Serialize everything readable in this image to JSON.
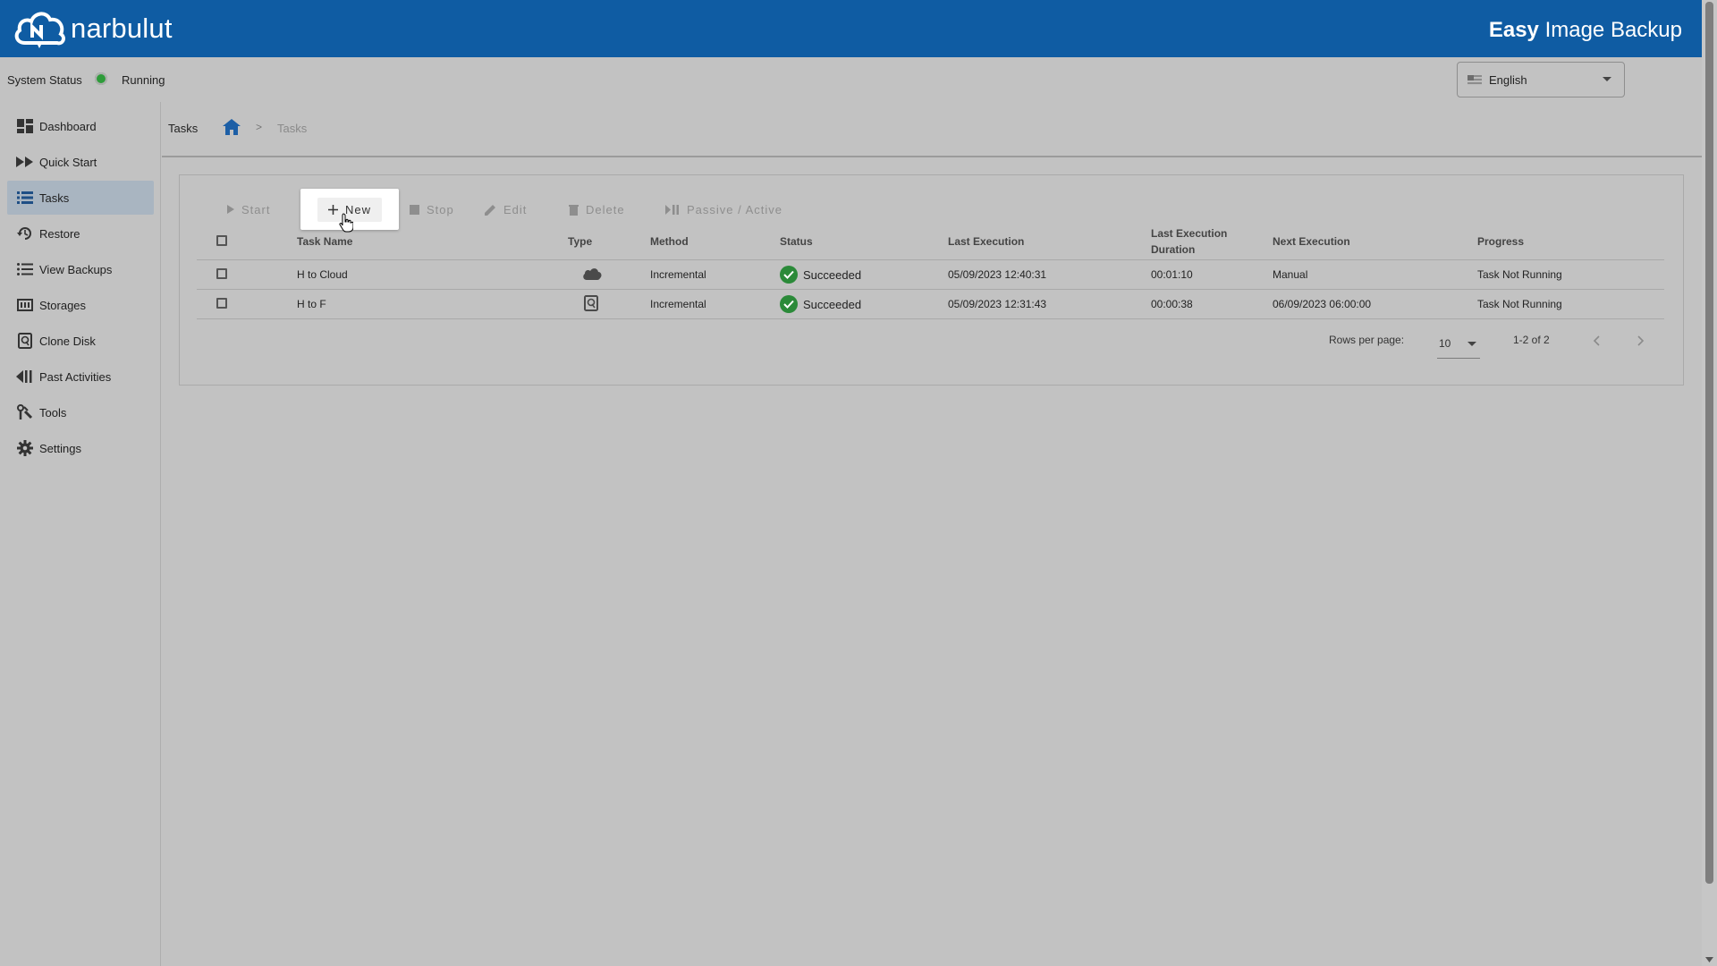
{
  "brand": {
    "logo_text": "narbulut"
  },
  "app_title": {
    "bold": "Easy",
    "rest": " Image Backup"
  },
  "status": {
    "label": "System Status",
    "value": "Running",
    "color": "#2e9c3a"
  },
  "language": {
    "selected": "English"
  },
  "sidebar": {
    "items": [
      {
        "label": "Dashboard",
        "icon": "dashboard-icon"
      },
      {
        "label": "Quick Start",
        "icon": "fast-forward-icon"
      },
      {
        "label": "Tasks",
        "icon": "list-icon",
        "active": true
      },
      {
        "label": "Restore",
        "icon": "restore-icon"
      },
      {
        "label": "View Backups",
        "icon": "list-bullets-icon"
      },
      {
        "label": "Storages",
        "icon": "storage-icon"
      },
      {
        "label": "Clone Disk",
        "icon": "disk-icon"
      },
      {
        "label": "Past Activities",
        "icon": "rewind-icon"
      },
      {
        "label": "Tools",
        "icon": "tools-icon"
      },
      {
        "label": "Settings",
        "icon": "gear-icon"
      }
    ]
  },
  "breadcrumb": {
    "title": "Tasks",
    "current": "Tasks",
    "separator": ">"
  },
  "toolbar": {
    "start": "Start",
    "new": "New",
    "stop": "Stop",
    "edit": "Edit",
    "delete": "Delete",
    "passive_active": "Passive / Active"
  },
  "table": {
    "headers": {
      "task_name": "Task Name",
      "type": "Type",
      "method": "Method",
      "status": "Status",
      "last_execution": "Last Execution",
      "last_execution_duration_1": "Last Execution",
      "last_execution_duration_2": "Duration",
      "next_execution": "Next Execution",
      "progress": "Progress"
    },
    "rows": [
      {
        "name": "H to Cloud",
        "type_icon": "cloud-icon",
        "method": "Incremental",
        "status": "Succeeded",
        "last_execution": "05/09/2023 12:40:31",
        "duration": "00:01:10",
        "next_execution": "Manual",
        "progress": "Task Not Running"
      },
      {
        "name": "H to F",
        "type_icon": "disk-icon",
        "method": "Incremental",
        "status": "Succeeded",
        "last_execution": "05/09/2023 12:31:43",
        "duration": "00:00:38",
        "next_execution": "06/09/2023 06:00:00",
        "progress": "Task Not Running"
      }
    ]
  },
  "pagination": {
    "rows_per_page_label": "Rows per page:",
    "rows_per_page": "10",
    "range": "1-2 of 2"
  },
  "colors": {
    "header": "#0f5ca3",
    "overlay_bg": "#c2c2c2",
    "success": "#2b8a39",
    "sidebar_active": "#a9b5c1"
  }
}
